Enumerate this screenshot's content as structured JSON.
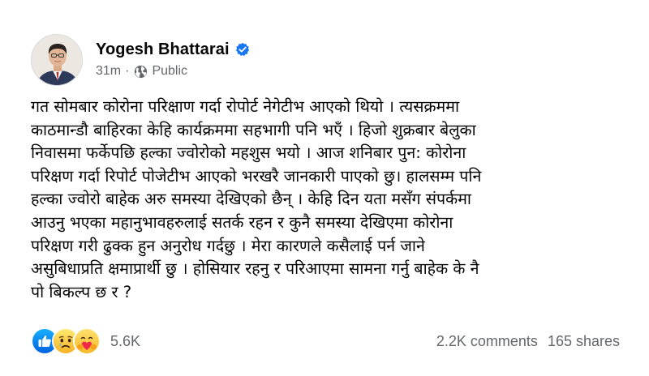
{
  "post": {
    "author": "Yogesh Bhattarai",
    "verified_icon": "verified-badge-icon",
    "time": "31m",
    "separator": "·",
    "privacy_icon": "globe-icon",
    "privacy": "Public",
    "body": "गत सोमबार कोरोना परिक्षाण गर्दा रोपोर्ट नेगेटीभ आएको थियो । त्यसक्रममा\nकाठमान्डौ बाहिरका केहि कार्यक्रममा सहभागी पनि भएँ । हिजो शुक्रबार बेलुका\nनिवासमा फर्केपछि हल्का ज्वोरोको महशुस भयो । आज शनिबार पुन: कोरोना\nपरिक्षण गर्दा रिपोर्ट पोजेटीभ आएको भरखरै जानकारी पाएको छु। हालसम्म पनि\nहल्का ज्वोरो बाहेक अरु समस्या देखिएको छैन् । केहि दिन यता मसँग संपर्कमा\nआउनु भएका महानुभावहरुलाई सतर्क रहन र कुनै समस्या देखिएमा कोरोना\nपरिक्षण गरी ढुक्क हुन अनुरोध गर्दछु । मेरा कारणले कसैलाई पर्न जाने\nअसुबिधाप्रति क्षमाप्रार्थी छु । होसियार रहनु र परिआएमा सामना गर्नु बाहेक के नै\nपो बिकल्प छ र ?"
  },
  "reactions": {
    "icons": [
      "like-icon",
      "sad-icon",
      "care-icon"
    ],
    "count": "5.6K"
  },
  "stats": {
    "comments": "2.2K comments",
    "shares": "165 shares"
  },
  "colors": {
    "facebook_blue": "#1877f2",
    "secondary_text": "#65676b",
    "sad_yellow": "#f7b125",
    "care_yellow": "#f7b928",
    "heart_red": "#f0284a"
  }
}
